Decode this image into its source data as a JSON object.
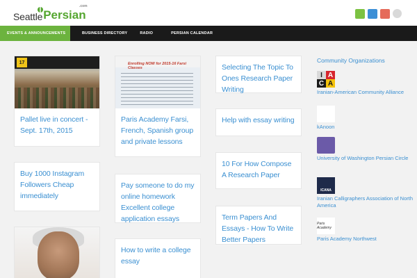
{
  "site": {
    "logo_seattle": "Seattle",
    "logo_persian": "Persian",
    "logo_dotcom": ".com"
  },
  "nav": {
    "items": [
      {
        "label": "Events & Announcements",
        "active": true
      },
      {
        "label": "Business Directory",
        "active": false
      },
      {
        "label": "Radio",
        "active": false
      },
      {
        "label": "Persian Calendar",
        "active": false
      }
    ]
  },
  "posts": {
    "col1": [
      {
        "title": "Pallet live in concert - Sept. 17th, 2015",
        "badge": "17"
      },
      {
        "title": "Buy 1000 Instagram Followers Cheap immediately"
      }
    ],
    "col2": [
      {
        "title": "Paris Academy Farsi, French, Spanish group and private lessons",
        "flyer_text": "Enrolling NOW for 2015-16 Farsi Classes"
      },
      {
        "title": "Pay someone to do my online homework Excellent college application essays"
      },
      {
        "title": "How to write a college essay"
      }
    ],
    "col3": [
      {
        "title": "Selecting The Topic To Ones Research Paper Writing"
      },
      {
        "title": "Help with essay writing"
      },
      {
        "title": "10 For How Compose A Research Paper"
      },
      {
        "title": "Term Papers And Essays - How To Write Better Papers"
      }
    ]
  },
  "sidebar": {
    "title": "Community Organizations",
    "orgs": [
      {
        "name": "Iranian-American Community Alliance",
        "logo_letters": [
          "I",
          "A",
          "C",
          "A"
        ]
      },
      {
        "name": "kAnoon",
        "logo_text": "kAnoon"
      },
      {
        "name": "University of Washington Persian Circle"
      },
      {
        "name": "Iranian Calligraphers Association of North America",
        "logo_text": "ICANA"
      },
      {
        "name": "Paris Academy Northwest",
        "logo_text": "Paris Academy"
      }
    ]
  },
  "colors": {
    "accent_green": "#6cb33e",
    "link_blue": "#3a8fd1",
    "nav_bg": "#1a1a1a"
  }
}
